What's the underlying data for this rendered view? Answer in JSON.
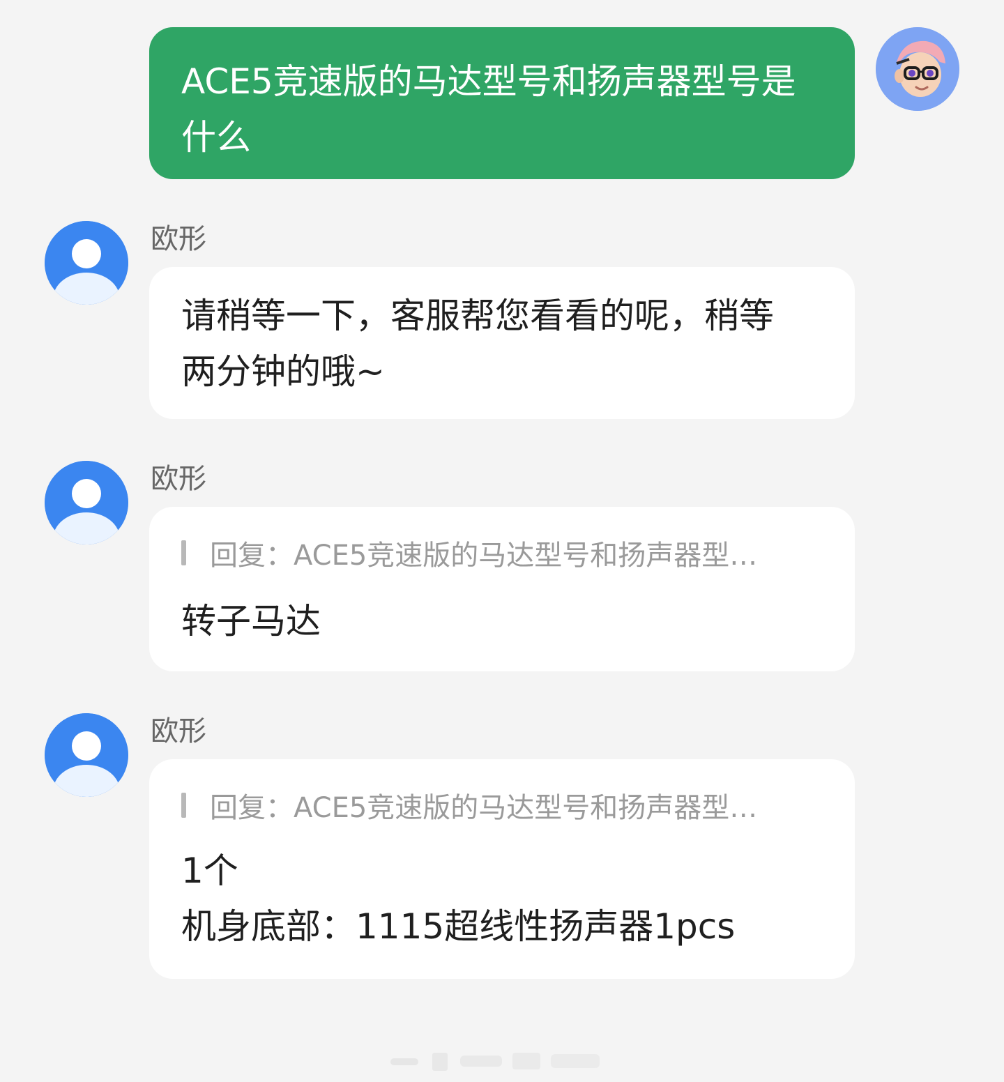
{
  "chat": {
    "user_message": {
      "text": "ACE5竞速版的马达型号和扬声器型号是\n什么"
    },
    "agent_messages": [
      {
        "sender": "欧形",
        "text": "请稍等一下，客服帮您看看的呢，稍等\n两分钟的哦~"
      },
      {
        "sender": "欧形",
        "quote": "回复：ACE5竞速版的马达型号和扬声器型…",
        "text": "转子马达"
      },
      {
        "sender": "欧形",
        "quote": "回复：ACE5竞速版的马达型号和扬声器型…",
        "text": "1个\n机身底部：1115超线性扬声器1pcs"
      }
    ]
  },
  "colors": {
    "user_bubble": "#2fa565",
    "agent_bubble": "#ffffff",
    "page_background": "#f4f4f4",
    "agent_avatar": "#3b86f0",
    "user_avatar": "#7ea4f3"
  },
  "icons": {
    "agent_avatar": "person-silhouette-icon",
    "user_avatar": "memoji-avatar-icon"
  }
}
